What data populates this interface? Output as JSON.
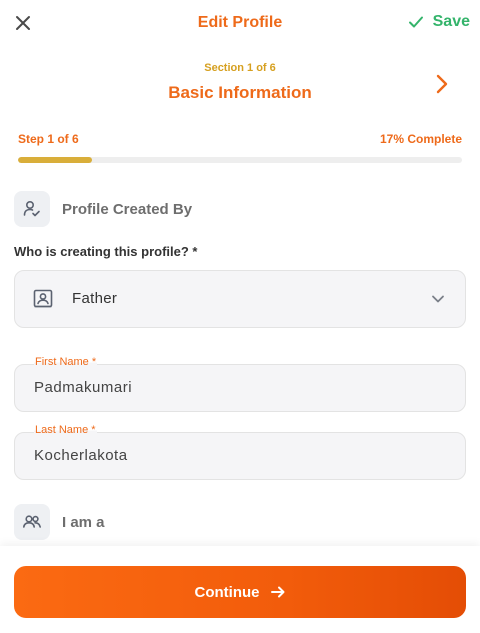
{
  "header": {
    "title": "Edit Profile",
    "save_label": "Save",
    "close_icon": "close-icon",
    "save_icon": "check-icon"
  },
  "section": {
    "count": "Section 1 of 6",
    "title": "Basic Information"
  },
  "progress": {
    "step_label": "Step 1 of 6",
    "complete_label": "17% Complete",
    "fraction": 0.167
  },
  "profile_created_by": {
    "label": "Profile Created By",
    "icon": "user-check-icon"
  },
  "question": {
    "label": "Who is creating this profile? *"
  },
  "created_by_select": {
    "value": "Father",
    "icon": "contact-badge-icon"
  },
  "first_name": {
    "label": "First Name *",
    "value": "Padmakumari"
  },
  "last_name": {
    "label": "Last Name *",
    "value": "Kocherlakota"
  },
  "i_am_a": {
    "label": "I am a",
    "icon": "users-icon"
  },
  "footer": {
    "continue_label": "Continue"
  },
  "colors": {
    "accent": "#ee6a1a",
    "save_green": "#34b46b",
    "progress_gold": "#d9ae3a"
  }
}
